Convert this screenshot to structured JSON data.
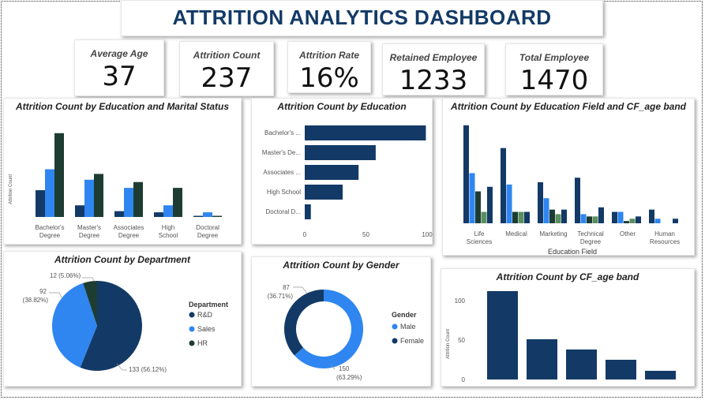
{
  "title": "ATTRITION  ANALYTICS DASHBOARD",
  "kpis": [
    {
      "label": "Average Age",
      "value": "37"
    },
    {
      "label": "Attrition Count",
      "value": "237"
    },
    {
      "label": "Attrition Rate",
      "value": "16%"
    },
    {
      "label": "Retained Employee",
      "value": "1233"
    },
    {
      "label": "Total Employee",
      "value": "1470"
    }
  ],
  "colors": {
    "dark_navy": "#133a66",
    "blue": "#2f86f0",
    "dark_green": "#1d3d33",
    "green": "#5a8f5f",
    "title": "#133a66"
  },
  "chart_data": [
    {
      "type": "bar",
      "title": "Attrition Count by Education and Marital Status",
      "ylabel": "Attrition Count",
      "categories": [
        "Bachelor's Degree",
        "Master's Degree",
        "Associates Degree",
        "High School",
        "Doctoral Degree"
      ],
      "series": [
        {
          "values": [
            23,
            10,
            5,
            4,
            1
          ],
          "color": "#133a66"
        },
        {
          "values": [
            41,
            32,
            25,
            10,
            4
          ],
          "color": "#2f86f0"
        },
        {
          "values": [
            72,
            37,
            30,
            25,
            1
          ],
          "color": "#1d3d33"
        }
      ],
      "ylim": [
        0,
        80
      ]
    },
    {
      "type": "bar",
      "orientation": "horizontal",
      "title": "Attrition Count by Education",
      "categories": [
        "Bachelor's ...",
        "Master's De...",
        "Associates ...",
        "High School",
        "Doctoral D..."
      ],
      "values": [
        99,
        58,
        44,
        31,
        5
      ],
      "xticks": [
        "0",
        "50",
        "100"
      ],
      "xlim": [
        0,
        100
      ]
    },
    {
      "type": "bar",
      "title": "Attrition Count by Education Field and CF_age band",
      "xlabel": "Education Field",
      "categories": [
        "Life Sciences",
        "Medical",
        "Marketing",
        "Technical Degree",
        "Other",
        "Human Resources"
      ],
      "series": [
        {
          "values": [
            43,
            33,
            18,
            20,
            5,
            6
          ],
          "color": "#133a66"
        },
        {
          "values": [
            22,
            17,
            11,
            4,
            5,
            2
          ],
          "color": "#2f86f0"
        },
        {
          "values": [
            14,
            5,
            6,
            3,
            1,
            0
          ],
          "color": "#1d3d33"
        },
        {
          "values": [
            5,
            5,
            4,
            3,
            2,
            0
          ],
          "color": "#5a8f5f"
        },
        {
          "values": [
            16,
            5,
            6,
            7,
            3,
            2
          ],
          "color": "#133a66"
        }
      ],
      "ylim": [
        0,
        45
      ]
    },
    {
      "type": "pie",
      "title": "Attrition Count by Department",
      "legend_title": "Department",
      "slices": [
        {
          "label": "R&D",
          "value": 133,
          "text": "133 (56.12%)",
          "color": "#133a66"
        },
        {
          "label": "Sales",
          "value": 92,
          "text": "92 (38.82%)",
          "color": "#2f86f0"
        },
        {
          "label": "HR",
          "value": 12,
          "text": "12 (5.06%)",
          "color": "#1d3d33"
        }
      ]
    },
    {
      "type": "pie",
      "donut": true,
      "title": "Attrition Count by Gender",
      "legend_title": "Gender",
      "slices": [
        {
          "label": "Male",
          "value": 150,
          "text": "150 (63.29%)",
          "color": "#2f86f0"
        },
        {
          "label": "Female",
          "value": 87,
          "text": "87 (36.71%)",
          "color": "#133a66"
        }
      ]
    },
    {
      "type": "bar",
      "title": "Attrition Count by CF_age band",
      "ylabel": "Attrition Count",
      "values": [
        112,
        51,
        38,
        25,
        11
      ],
      "yticks": [
        "0",
        "50",
        "100"
      ],
      "ylim": [
        0,
        120
      ]
    }
  ]
}
